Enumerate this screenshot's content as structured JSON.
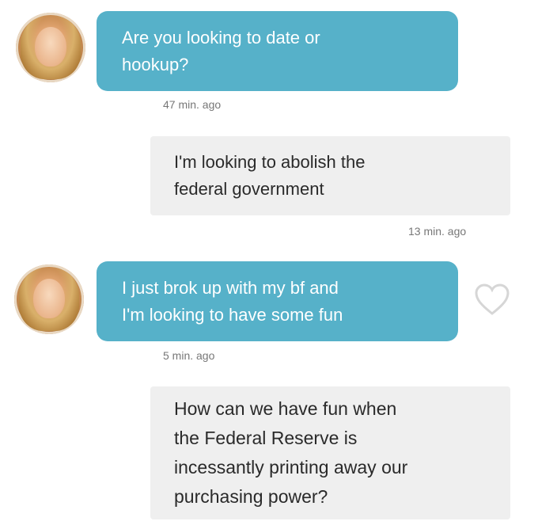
{
  "messages": [
    {
      "from": "them",
      "lines": [
        "Are you looking to date or",
        "hookup?"
      ],
      "time": "47 min. ago"
    },
    {
      "from": "me",
      "lines": [
        "I'm looking to abolish the",
        "federal government"
      ],
      "time": "13 min. ago"
    },
    {
      "from": "them",
      "lines": [
        "I just brok up with my bf and",
        "I'm looking to have some fun"
      ],
      "time": "5 min. ago"
    },
    {
      "from": "me",
      "lines": [
        "How can we have fun when",
        "the Federal Reserve is",
        "incessantly printing away our",
        "purchasing power?"
      ]
    }
  ],
  "icons": {
    "avatar": "profile-photo",
    "like": "heart-outline-icon"
  },
  "colors": {
    "incoming_bubble": "#56b1c9",
    "outgoing_bubble": "#efefef",
    "timestamp": "#777777"
  }
}
